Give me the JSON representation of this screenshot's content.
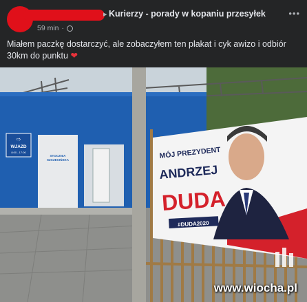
{
  "post": {
    "group_name": "Kurierzy - porady w kopaniu przesyłek",
    "timestamp": "59 min",
    "text_line1": "Miałem paczkę dostarczyć, ale zobaczyłem ten plakat i cyk awizo i odbiór",
    "text_line2": "30km do punktu",
    "more": "•••"
  },
  "photo": {
    "sign_wjazd": "WJAZD",
    "sign_hours": "8:00 - 17:00",
    "door_sign_line1": "STOCZNIA",
    "door_sign_line2": "SZCZECIŃSKA",
    "banner": {
      "line1": "MÓJ PREZYDENT",
      "line2": "ANDRZEJ",
      "line3": "DUDA",
      "hashtag": "#DUDA2020"
    },
    "watermark": "www.wiocha.pl"
  },
  "colors": {
    "redaction": "#e0101a",
    "banner_red": "#d4212b",
    "banner_navy": "#1e2a5a",
    "building_blue": "#1f5fb0"
  }
}
